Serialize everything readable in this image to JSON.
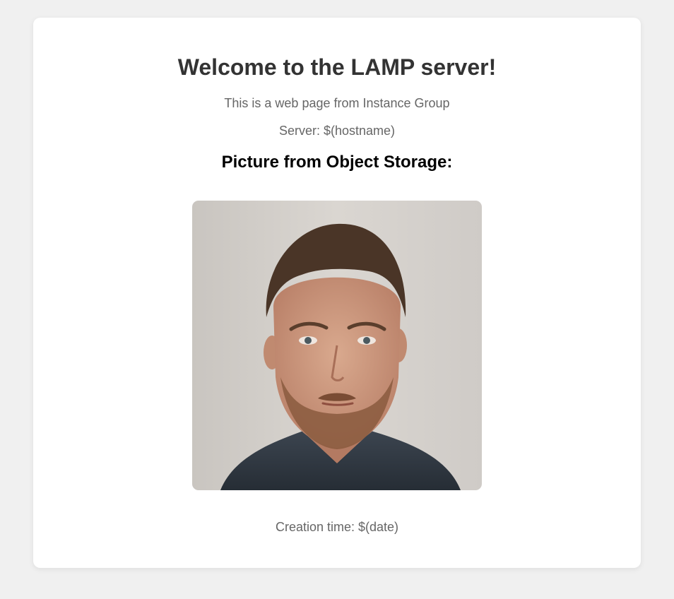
{
  "page": {
    "title": "Welcome to the LAMP server!",
    "subtitle": "This is a web page from Instance Group",
    "server_line": "Server: $(hostname)",
    "picture_heading": "Picture from Object Storage:",
    "creation_time": "Creation time: $(date)"
  },
  "colors": {
    "background": "#f0f0f0",
    "card": "#ffffff",
    "title": "#333333",
    "text": "#666666"
  }
}
